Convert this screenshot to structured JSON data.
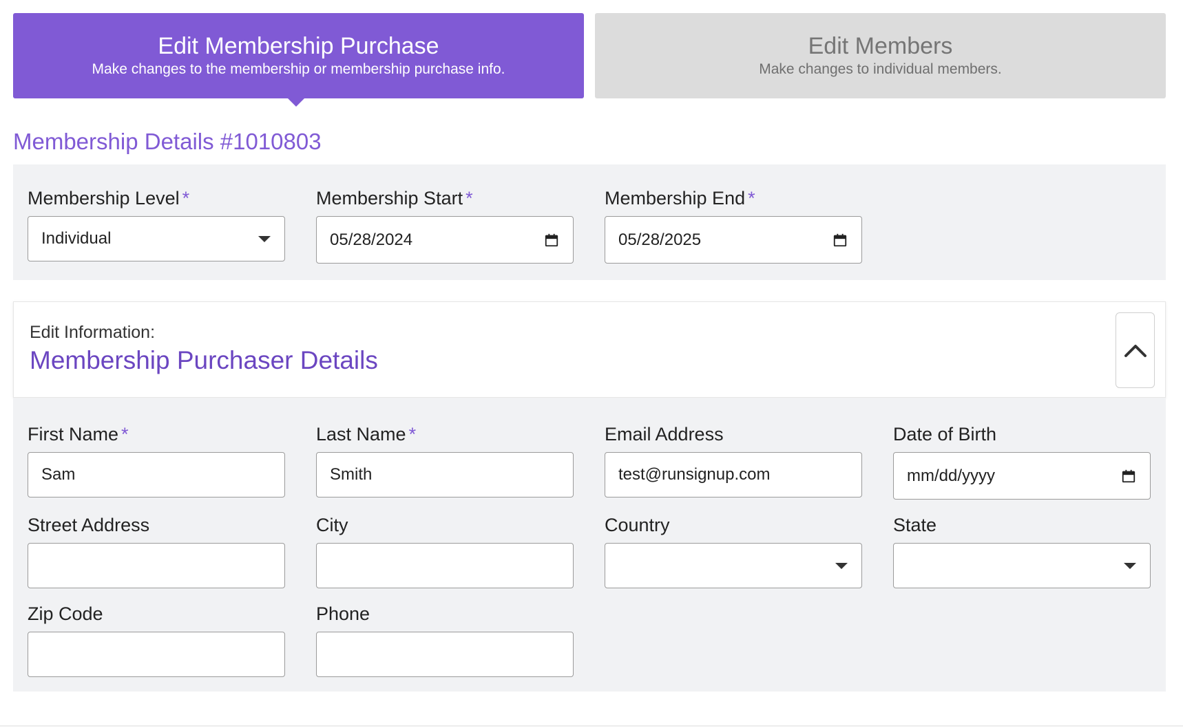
{
  "tabs": [
    {
      "title": "Edit Membership Purchase",
      "subtitle": "Make changes to the membership or membership purchase info."
    },
    {
      "title": "Edit Members",
      "subtitle": "Make changes to individual members."
    }
  ],
  "membership": {
    "heading": "Membership Details #1010803",
    "level": {
      "label": "Membership Level",
      "required": "*",
      "value": "Individual"
    },
    "start": {
      "label": "Membership Start",
      "required": "*",
      "value": "05/28/2024"
    },
    "end": {
      "label": "Membership End",
      "required": "*",
      "value": "05/28/2025"
    }
  },
  "purchaser": {
    "kicker": "Edit Information:",
    "title": "Membership Purchaser Details",
    "first_name": {
      "label": "First Name",
      "required": "*",
      "value": "Sam"
    },
    "last_name": {
      "label": "Last Name",
      "required": "*",
      "value": "Smith"
    },
    "email": {
      "label": "Email Address",
      "value": "test@runsignup.com"
    },
    "dob": {
      "label": "Date of Birth",
      "value": "mm/dd/yyyy"
    },
    "street": {
      "label": "Street Address",
      "value": ""
    },
    "city": {
      "label": "City",
      "value": ""
    },
    "country": {
      "label": "Country",
      "value": ""
    },
    "state": {
      "label": "State",
      "value": ""
    },
    "zip": {
      "label": "Zip Code",
      "value": ""
    },
    "phone": {
      "label": "Phone",
      "value": ""
    }
  },
  "colors": {
    "accent": "#805ad5",
    "title_purple": "#6b46c1",
    "panel_bg": "#f1f2f4",
    "inactive_tab": "#dcdcdc"
  },
  "icons": {
    "calendar": "calendar-icon",
    "caret": "chevron-down-icon",
    "collapse": "chevron-up-icon"
  }
}
